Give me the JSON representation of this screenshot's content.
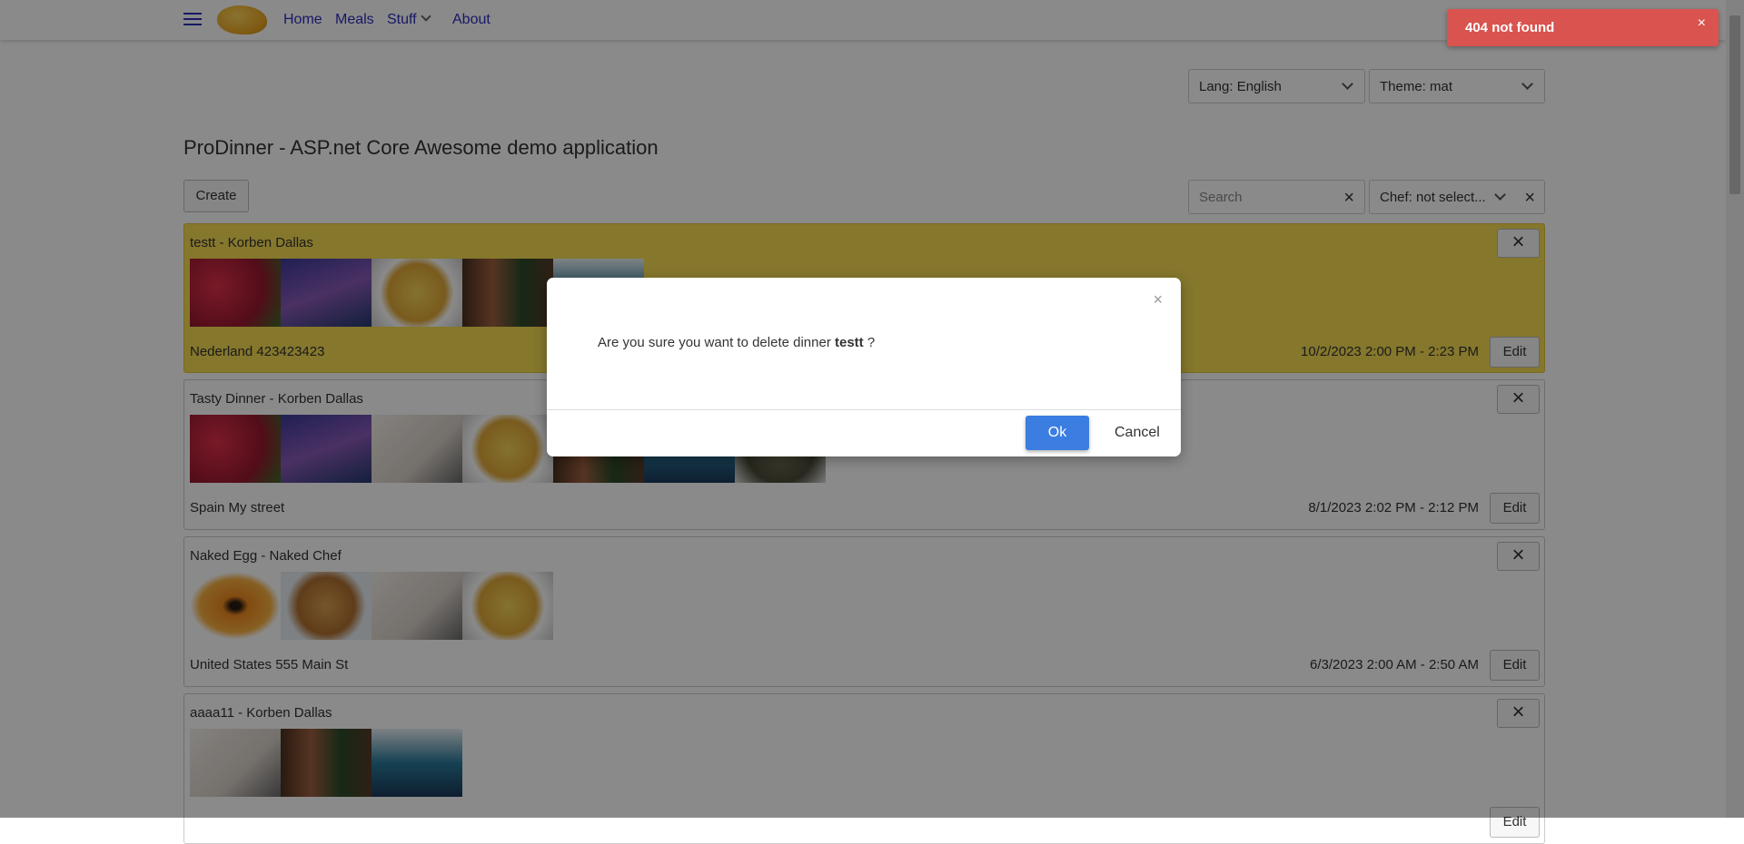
{
  "nav": {
    "home": "Home",
    "meals": "Meals",
    "stuff": "Stuff",
    "about": "About"
  },
  "lang": "Lang: English",
  "theme": "Theme: mat",
  "title": "ProDinner - ASP.net Core Awesome demo application",
  "create": "Create",
  "search": {
    "placeholder": "Search"
  },
  "chef": "Chef: not select...",
  "dinners": [
    {
      "title": "testt - Korben Dallas",
      "location": "Nederland 423423423",
      "date": "10/2/2023 2:00 PM - 2:23 PM",
      "edit": "Edit"
    },
    {
      "title": "Tasty Dinner - Korben Dallas",
      "location": "Spain My street",
      "date": "8/1/2023 2:02 PM - 2:12 PM",
      "edit": "Edit"
    },
    {
      "title": "Naked Egg - Naked Chef",
      "location": "United States 555 Main St",
      "date": "6/3/2023 2:00 AM - 2:50 AM",
      "edit": "Edit"
    },
    {
      "title": "aaaa11 - Korben Dallas",
      "edit": "Edit"
    }
  ],
  "highlight_color": "#f6dc52",
  "modal": {
    "message": "Are you sure you want to delete dinner ",
    "name": "testt",
    "suffix": " ?",
    "ok": "Ok",
    "cancel": "Cancel",
    "close": "×"
  },
  "toast": {
    "text": "404 not found",
    "close": "×",
    "color": "#d9534f"
  },
  "icons": {
    "close": "×"
  }
}
